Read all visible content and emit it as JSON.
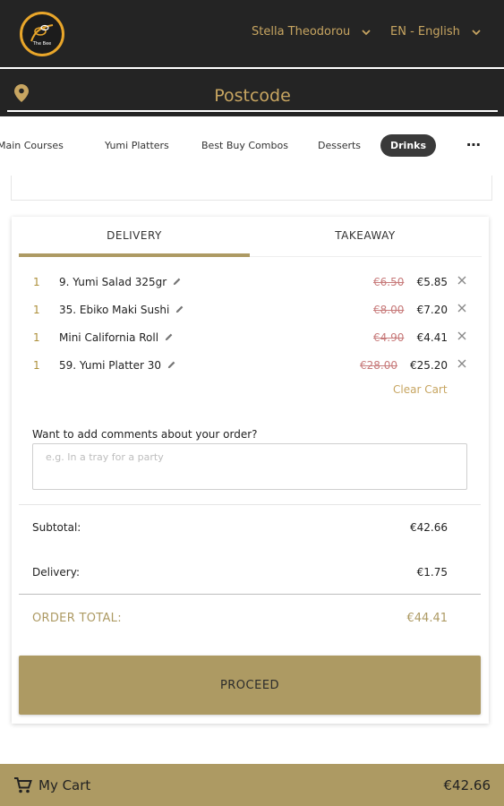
{
  "header": {
    "user_name": "Stella Theodorou",
    "language": "EN - English",
    "logo_icon": "bee-logo-icon"
  },
  "postcode": {
    "placeholder": "Postcode"
  },
  "categories": {
    "items": [
      {
        "label": "Main Courses"
      },
      {
        "label": "Yumi Platters"
      },
      {
        "label": "Best Buy Combos"
      },
      {
        "label": "Desserts"
      },
      {
        "label": "Drinks",
        "active": true
      }
    ],
    "more_label": "⋯"
  },
  "cart": {
    "tabs": [
      {
        "label": "DELIVERY",
        "active": true
      },
      {
        "label": "TAKEAWAY"
      }
    ],
    "items": [
      {
        "qty": "1",
        "name": "9. Yumi Salad 325gr",
        "old_price": "€6.50",
        "price": "€5.85"
      },
      {
        "qty": "1",
        "name": "35. Ebiko Maki Sushi",
        "old_price": "€8.00",
        "price": "€7.20"
      },
      {
        "qty": "1",
        "name": "Mini California Roll",
        "old_price": "€4.90",
        "price": "€4.41"
      },
      {
        "qty": "1",
        "name": "59. Yumi Platter 30",
        "old_price": "€28.00",
        "price": "€25.20"
      }
    ],
    "clear_cart": "Clear Cart",
    "comments_label": "Want to add comments about your order?",
    "comments_placeholder": "e.g. In a tray for a party",
    "subtotal_label": "Subtotal:",
    "subtotal_value": "€42.66",
    "delivery_label": "Delivery:",
    "delivery_value": "€1.75",
    "order_total_label": "ORDER TOTAL:",
    "order_total_value": "€44.41",
    "proceed_label": "PROCEED"
  },
  "bottom_bar": {
    "my_cart_label": "My Cart",
    "total": "€42.66"
  },
  "colors": {
    "dark_bg": "#242424",
    "gold": "#ad9a63",
    "gold_text": "#c7a561",
    "strike_red": "#c77a7a"
  }
}
